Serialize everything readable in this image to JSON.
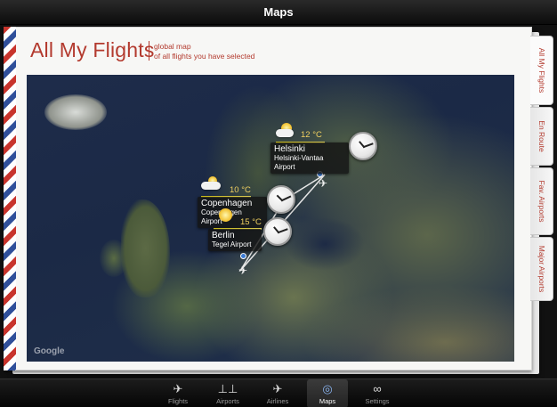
{
  "app": {
    "title": "Maps"
  },
  "header": {
    "title": "All My Flights",
    "subtitle_line1": "global map",
    "subtitle_line2": "of all flights you have selected"
  },
  "map": {
    "attribution": "Google"
  },
  "cities": [
    {
      "name": "Helsinki",
      "airport": "Helsinki-Vantaa Airport",
      "temp": "12 °C",
      "weather": "sun-cloud-icon"
    },
    {
      "name": "Copenhagen",
      "airport": "Copenhagen Airport",
      "temp": "10 °C",
      "weather": "cloud-rain-icon"
    },
    {
      "name": "Berlin",
      "airport": "Tegel Airport",
      "temp": "15 °C",
      "weather": "sun-icon"
    }
  ],
  "side_tabs": [
    "All My Flights",
    "En Route",
    "Fav. Airports",
    "Major Airports"
  ],
  "bottom_nav": [
    {
      "label": "Flights",
      "icon": "airplane-icon"
    },
    {
      "label": "Airports",
      "icon": "airport-icon"
    },
    {
      "label": "Airlines",
      "icon": "airline-icon"
    },
    {
      "label": "Maps",
      "icon": "globe-icon",
      "selected": true
    },
    {
      "label": "Settings",
      "icon": "gear-icon"
    }
  ],
  "colors": {
    "accent": "#b33a2e",
    "nav_selected": "#8ab4f0"
  }
}
